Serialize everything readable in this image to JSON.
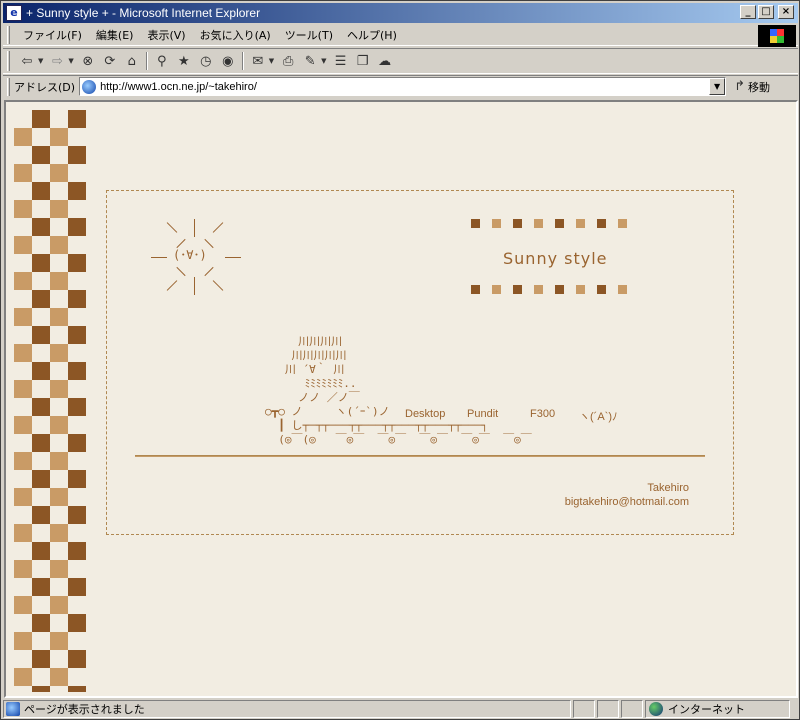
{
  "window": {
    "title": "+ Sunny style + - Microsoft Internet Explorer",
    "buttons": [
      "_",
      "□",
      "×"
    ]
  },
  "menu": {
    "items": [
      "ファイル(F)",
      "編集(E)",
      "表示(V)",
      "お気に入り(A)",
      "ツール(T)",
      "ヘルプ(H)"
    ]
  },
  "toolbar": {
    "icons": [
      "back-icon",
      "forward-icon",
      "stop-icon",
      "refresh-icon",
      "home-icon",
      "search-icon",
      "favorites-icon",
      "history-icon",
      "media-icon",
      "mail-icon",
      "print-icon",
      "edit-icon",
      "discuss-icon",
      "research-icon",
      "messenger-icon"
    ]
  },
  "address": {
    "label": "アドレス(D)",
    "url": "http://www1.ocn.ne.jp/~takehiro/",
    "go_label": "移動"
  },
  "page": {
    "brand": "Sunny style",
    "sun_face": "(･∀･)",
    "ascii_art": "     川川川川\n    川川川川川\n   川 ´∀｀ 川\n      ﾐﾐﾐﾐﾐﾐﾐ..\n     ノノ ／ノ￣\n○┳○ ノ     ヽ(´ｰ`)ノ\n  ┃ し┬─┬┬───┬┬───┬┬───┬┬───┬┬───┐\n  (◎￣(◎   ￣◎￣  ￣◎￣  ￣◎￣  ￣◎￣  ￣◎￣",
    "train_labels": [
      "Desktop",
      "Pundit",
      "F300",
      "ヽ(´A`)ﾉ"
    ],
    "signature_name": "Takehiro",
    "signature_email": "bigtakehiro@hotmail.com",
    "colors": {
      "dark": "#8c5625",
      "light": "#c99b66",
      "background": "#f2ede2",
      "text": "#9a6430"
    }
  },
  "status": {
    "text": "ページが表示されました",
    "zone": "インターネット"
  }
}
